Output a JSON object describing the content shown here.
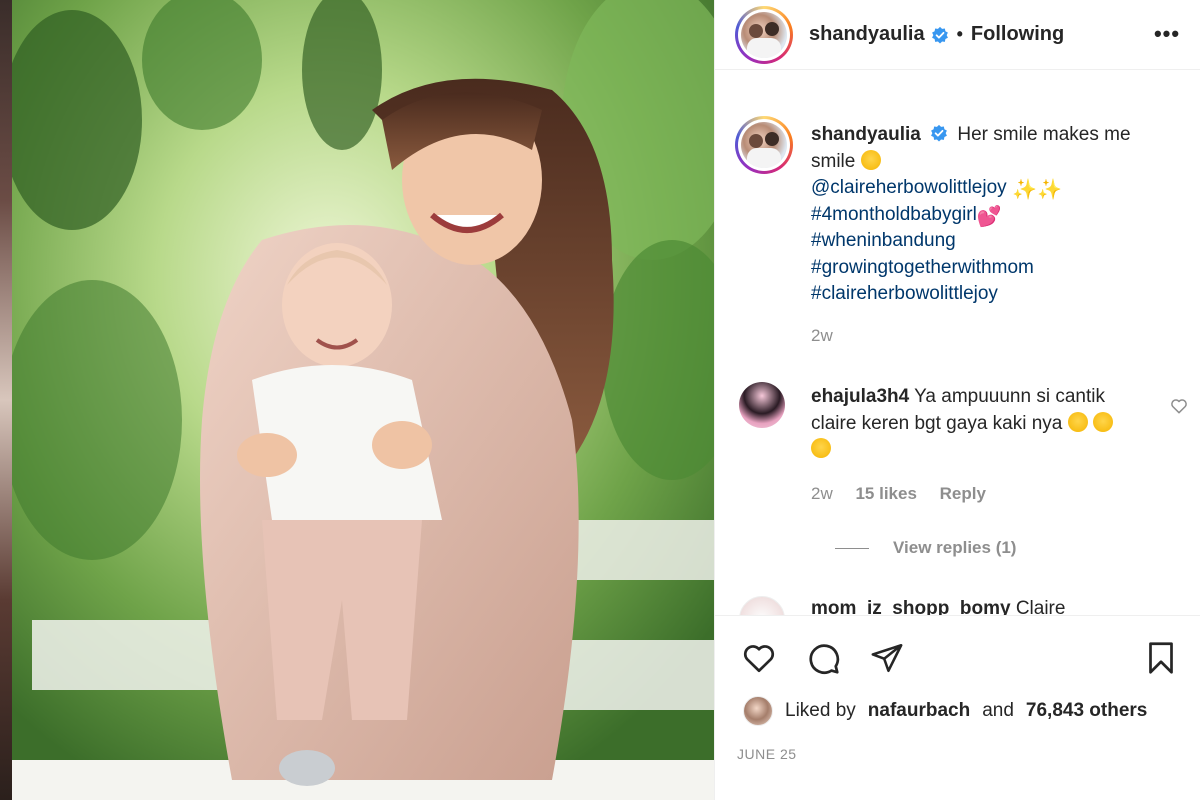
{
  "post": {
    "username": "shandyaulia",
    "follow_status": "Following",
    "separator": "•",
    "more_label": "•••"
  },
  "caption": {
    "username": "shandyaulia",
    "text": "Her smile makes me smile",
    "mention": "@claireherbowolittlejoy",
    "hashtags": [
      "#4montholdbabygirl",
      "#wheninbandung",
      "#growingtogetherwithmom",
      "#claireherbowolittlejoy"
    ],
    "time": "2w"
  },
  "comments": [
    {
      "username": "ehajula3h4",
      "text": "Ya ampuuunn si cantik claire keren bgt gaya kaki nya",
      "time": "2w",
      "likes": "15 likes",
      "reply_label": "Reply",
      "view_replies": "View replies (1)"
    },
    {
      "username": "mom_iz_shopp_bomy",
      "text": "Claire"
    }
  ],
  "actions": {
    "liked_by_prefix": "Liked by",
    "liked_by_user": "nafaurbach",
    "and_label": "and",
    "others_count": "76,843 others",
    "date": "JUNE 25"
  },
  "colors": {
    "hashtag": "#00376b",
    "verified": "#3897f0",
    "muted": "#8e8e8e"
  }
}
